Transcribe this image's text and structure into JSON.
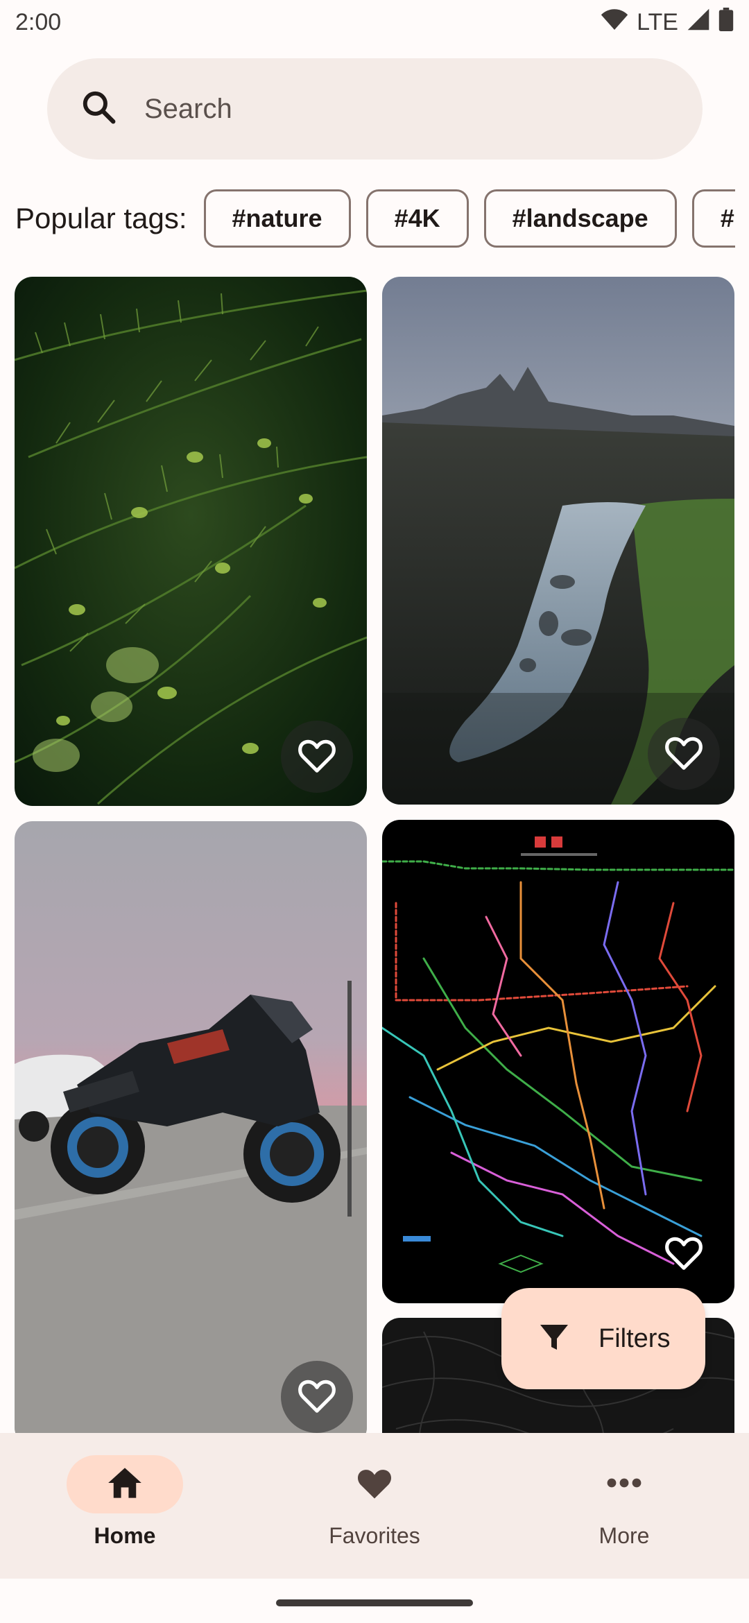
{
  "status_bar": {
    "time": "2:00",
    "network": "LTE"
  },
  "search": {
    "placeholder": "Search"
  },
  "tags": {
    "label": "Popular tags:",
    "items": [
      "#nature",
      "#4K",
      "#landscape",
      "#"
    ]
  },
  "fab": {
    "label": "Filters"
  },
  "bottom_nav": {
    "items": [
      {
        "label": "Home",
        "icon": "home-icon",
        "active": true
      },
      {
        "label": "Favorites",
        "icon": "heart-icon",
        "active": false
      },
      {
        "label": "More",
        "icon": "more-horiz-icon",
        "active": false
      }
    ]
  },
  "wallpapers": [
    {
      "subject": "pine branches",
      "favorite": false
    },
    {
      "subject": "mountain river valley",
      "favorite": false
    },
    {
      "subject": "black sport motorcycle at dusk",
      "favorite": false
    },
    {
      "subject": "metro map on black",
      "favorite": false
    },
    {
      "subject": "dark texture",
      "favorite": false
    }
  ],
  "colors": {
    "accent": "#ffdbcb",
    "surface": "#fffbfa",
    "search_bg": "#f4ebe7",
    "nav_bg": "#f6ece8",
    "chip_border": "#85736d"
  }
}
